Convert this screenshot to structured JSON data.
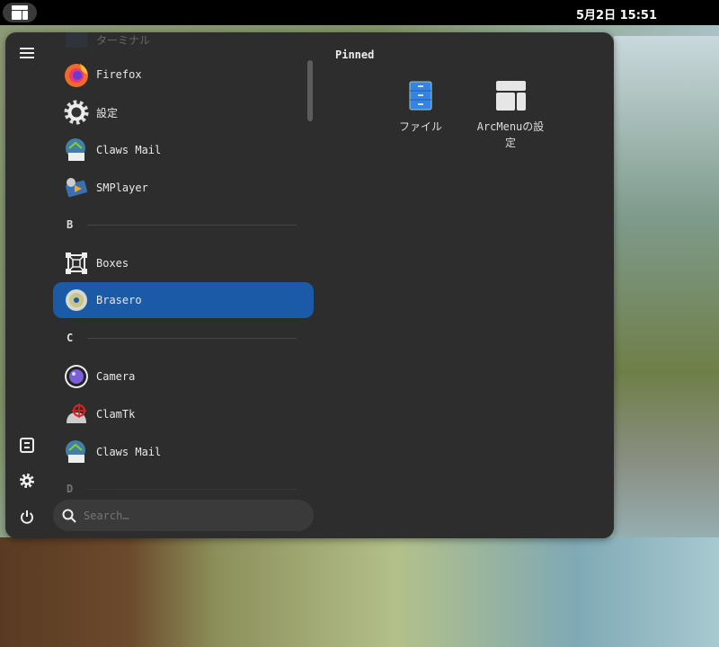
{
  "topbar": {
    "clock": "5月2日  15:51"
  },
  "apps": {
    "partial_top": "ターミナル",
    "items": [
      {
        "label": "Firefox",
        "icon": "firefox-icon"
      },
      {
        "label": "設定",
        "icon": "settings-gear-icon"
      },
      {
        "label": "Claws Mail",
        "icon": "claws-mail-icon"
      },
      {
        "label": "SMPlayer",
        "icon": "smplayer-icon"
      },
      {
        "label": "Boxes",
        "icon": "boxes-icon"
      },
      {
        "label": "Brasero",
        "icon": "brasero-disc-icon",
        "selected": true
      },
      {
        "label": "Camera",
        "icon": "camera-icon"
      },
      {
        "label": "ClamTk",
        "icon": "clamtk-icon"
      },
      {
        "label": "Claws Mail",
        "icon": "claws-mail-icon"
      }
    ],
    "headers": {
      "b": "B",
      "c": "C",
      "d": "D"
    }
  },
  "search": {
    "placeholder": "Search…"
  },
  "pinned": {
    "title": "Pinned",
    "items": [
      {
        "label": "ファイル"
      },
      {
        "label": "ArcMenuの設定"
      }
    ]
  },
  "colors": {
    "selected": "#1a5aa6",
    "panel": "#2d2d2d"
  }
}
